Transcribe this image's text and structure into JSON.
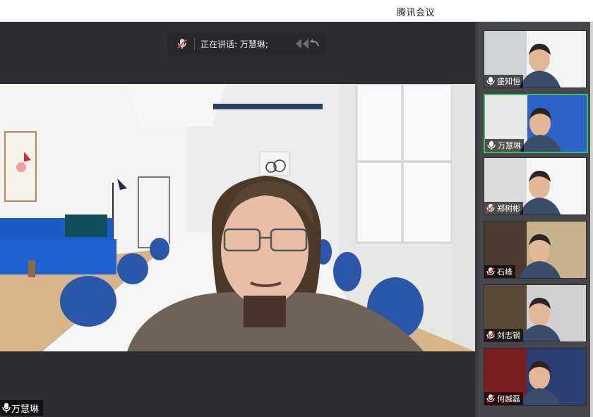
{
  "window": {
    "title": "腾讯会议"
  },
  "speaking": {
    "text": "正在讲话: 万慧琳;"
  },
  "main_video": {
    "participant_name": "万慧琳"
  },
  "participants": [
    {
      "name": "盛知恒",
      "muted": false,
      "active": false
    },
    {
      "name": "万慧琳",
      "muted": false,
      "active": true
    },
    {
      "name": "郑树彬",
      "muted": true,
      "active": false
    },
    {
      "name": "石峰",
      "muted": true,
      "active": false
    },
    {
      "name": "刘志钢",
      "muted": true,
      "active": false
    },
    {
      "name": "何越磊",
      "muted": true,
      "active": false
    }
  ],
  "colors": {
    "active_border": "#33c36a",
    "muted_icon": "#e04848",
    "mic_icon": "#ffffff"
  }
}
